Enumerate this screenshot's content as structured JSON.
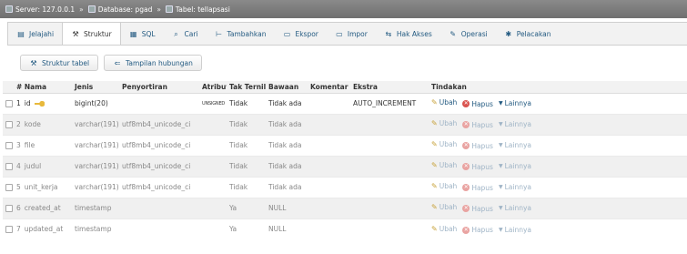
{
  "breadcrumb": {
    "items": [
      {
        "icon": "server-icon",
        "label": "Server: 127.0.0.1"
      },
      {
        "icon": "database-icon",
        "label": "Database: pgad"
      },
      {
        "icon": "table-icon",
        "label": "Tabel: tellapsasi"
      }
    ],
    "separator": "»"
  },
  "tabs": [
    {
      "icon": "browse-icon",
      "glyph": "▤",
      "label": "Jelajahi"
    },
    {
      "icon": "structure-icon",
      "glyph": "⚒",
      "label": "Struktur",
      "active": true
    },
    {
      "icon": "sql-icon",
      "glyph": "▦",
      "label": "SQL"
    },
    {
      "icon": "search-icon",
      "glyph": "⌕",
      "label": "Cari"
    },
    {
      "icon": "insert-icon",
      "glyph": "⊢",
      "label": "Tambahkan"
    },
    {
      "icon": "export-icon",
      "glyph": "▭",
      "label": "Ekspor"
    },
    {
      "icon": "import-icon",
      "glyph": "▭",
      "label": "Impor"
    },
    {
      "icon": "privileges-icon",
      "glyph": "⇆",
      "label": "Hak Akses"
    },
    {
      "icon": "operations-icon",
      "glyph": "✎",
      "label": "Operasi"
    },
    {
      "icon": "tracking-icon",
      "glyph": "✱",
      "label": "Pelacakan"
    }
  ],
  "subtabs": [
    {
      "icon": "table-structure-icon",
      "glyph": "⚒",
      "label": "Struktur tabel"
    },
    {
      "icon": "relation-view-icon",
      "glyph": "⇐",
      "label": "Tampilan hubungan"
    }
  ],
  "table": {
    "headers": [
      "",
      "# Nama",
      "Jenis",
      "Penyortiran",
      "Atribut",
      "Tak Ternilai",
      "Bawaan",
      "Komentar",
      "Ekstra",
      "Tindakan"
    ],
    "rows": [
      {
        "num": "1",
        "name": "id",
        "primary": true,
        "type": "bigint(20)",
        "collation": "",
        "attributes": "UNSIGNED",
        "null": "Tidak",
        "default": "Tidak ada",
        "comment": "",
        "extra": "AUTO_INCREMENT"
      },
      {
        "num": "2",
        "name": "kode",
        "type": "varchar(191)",
        "collation": "utf8mb4_unicode_ci",
        "attributes": "",
        "null": "Tidak",
        "default": "Tidak ada",
        "comment": "",
        "extra": ""
      },
      {
        "num": "3",
        "name": "file",
        "type": "varchar(191)",
        "collation": "utf8mb4_unicode_ci",
        "attributes": "",
        "null": "Tidak",
        "default": "Tidak ada",
        "comment": "",
        "extra": ""
      },
      {
        "num": "4",
        "name": "judul",
        "type": "varchar(191)",
        "collation": "utf8mb4_unicode_ci",
        "attributes": "",
        "null": "Tidak",
        "default": "Tidak ada",
        "comment": "",
        "extra": ""
      },
      {
        "num": "5",
        "name": "unit_kerja",
        "type": "varchar(191)",
        "collation": "utf8mb4_unicode_ci",
        "attributes": "",
        "null": "Tidak",
        "default": "Tidak ada",
        "comment": "",
        "extra": ""
      },
      {
        "num": "6",
        "name": "created_at",
        "type": "timestamp",
        "collation": "",
        "attributes": "",
        "null": "Ya",
        "default": "NULL",
        "comment": "",
        "extra": ""
      },
      {
        "num": "7",
        "name": "updated_at",
        "type": "timestamp",
        "collation": "",
        "attributes": "",
        "null": "Ya",
        "default": "NULL",
        "comment": "",
        "extra": ""
      }
    ],
    "actions": {
      "edit": "Ubah",
      "drop": "Hapus",
      "more": "Lainnya"
    }
  },
  "colors": {
    "link": "#235a81",
    "header_bg": "#f2f2f2",
    "breadcrumb_bg": "#7a7a7a",
    "drop": "#d9534f",
    "key": "#e8b93c"
  }
}
